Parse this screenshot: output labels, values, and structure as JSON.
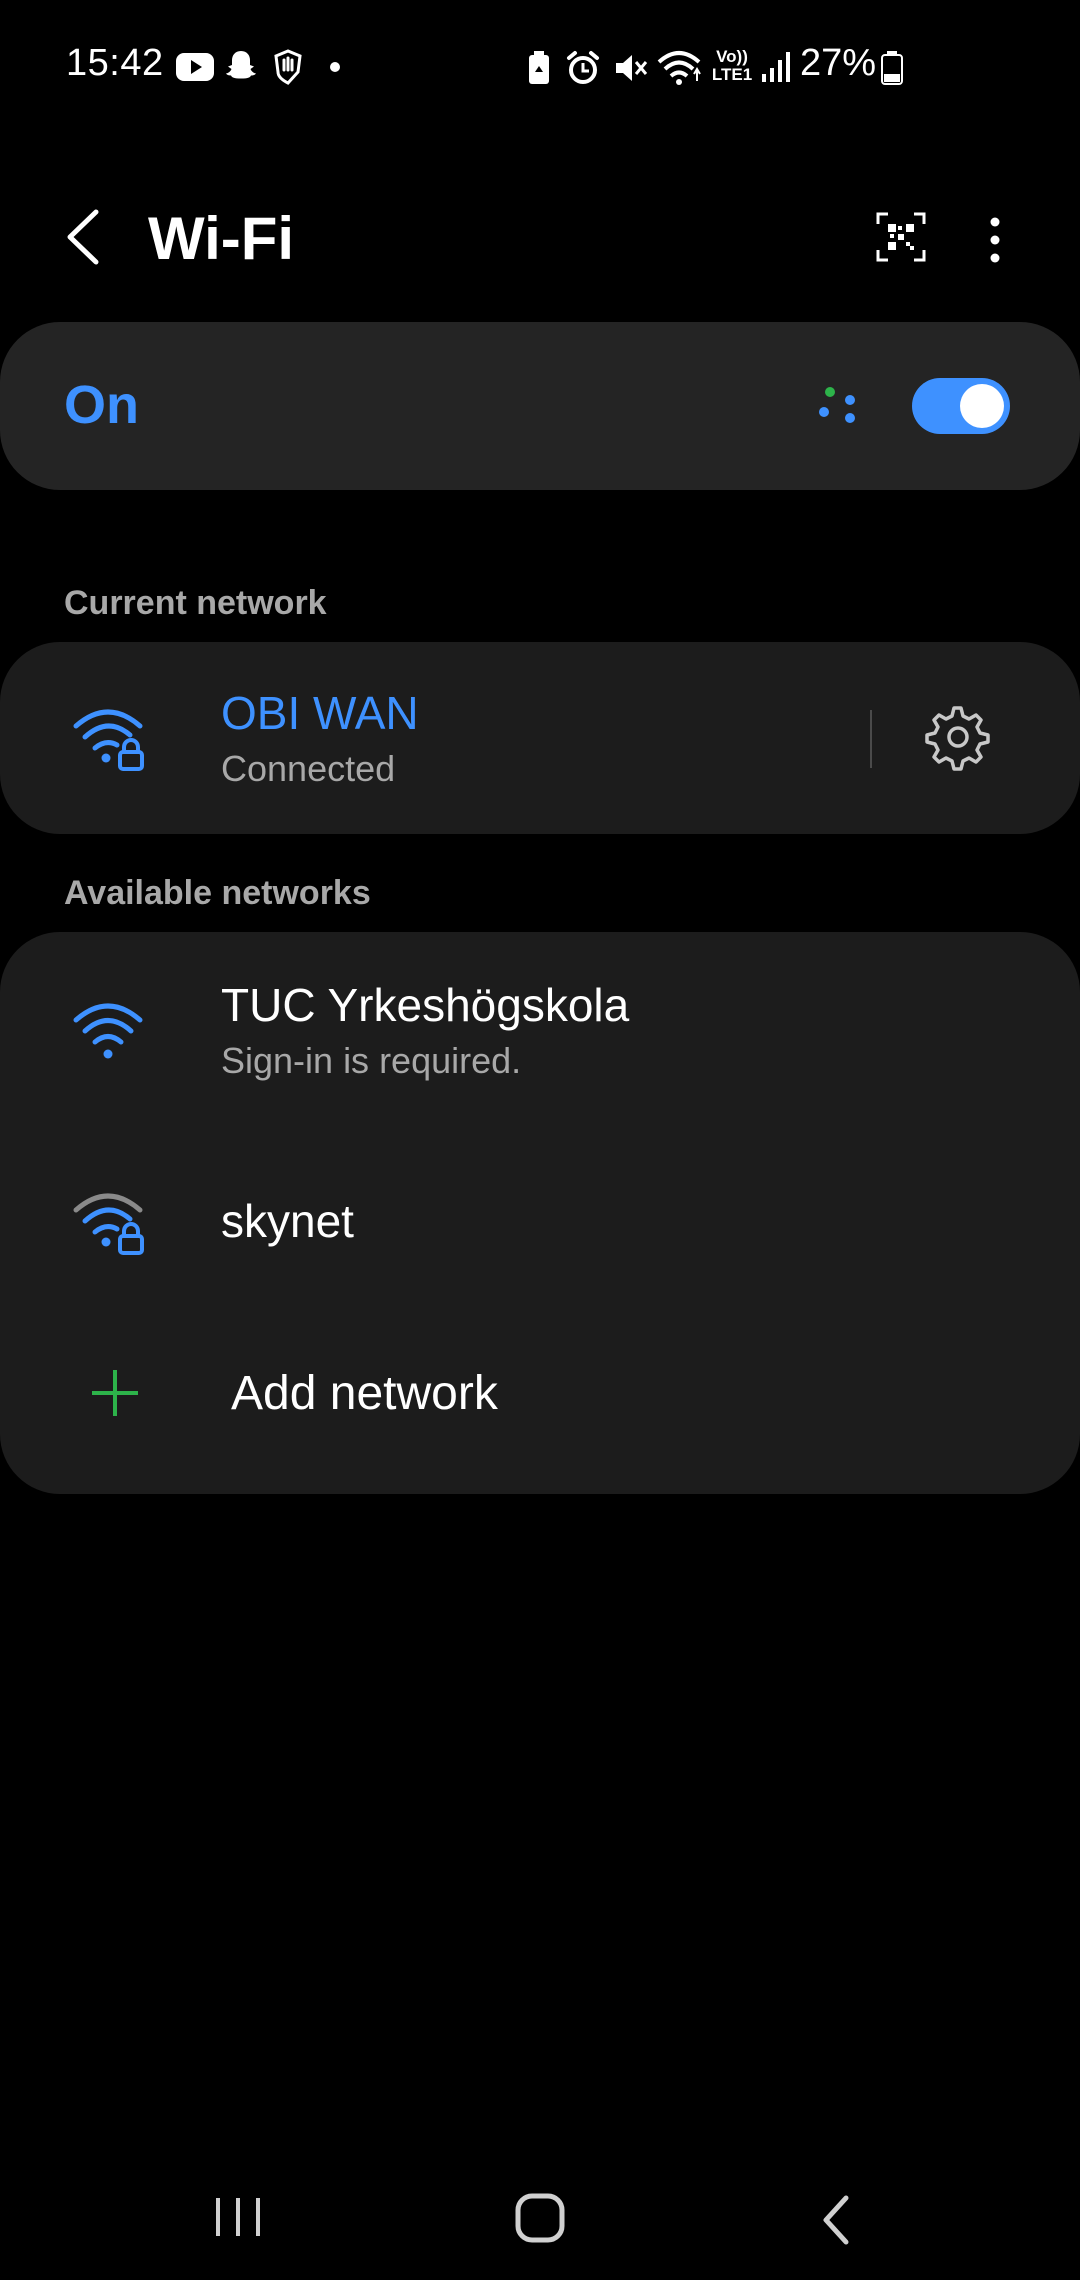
{
  "status_bar": {
    "time": "15:42",
    "battery_percent": "27%",
    "left_icons": [
      "youtube-icon",
      "snapchat-icon",
      "hand-icon",
      "dot-icon"
    ],
    "right_icons": [
      "battery-saver-icon",
      "alarm-icon",
      "mute-icon",
      "wifi-icon",
      "volte-icon",
      "signal-icon",
      "battery-icon"
    ],
    "volte_text": "Vo))",
    "lte_text": "LTE1"
  },
  "header": {
    "title": "Wi-Fi",
    "back_icon": "back-arrow-icon",
    "qr_icon": "qr-scanner-icon",
    "more_icon": "more-vert-icon"
  },
  "wifi_toggle": {
    "label": "On",
    "enabled": true
  },
  "current_network": {
    "section_title": "Current network",
    "name": "OBI WAN",
    "status": "Connected",
    "secured": true
  },
  "available_networks": {
    "section_title": "Available networks",
    "items": [
      {
        "name": "TUC Yrkeshögskola",
        "status": "Sign-in is required.",
        "secured": false
      },
      {
        "name": "skynet",
        "status": "",
        "secured": true
      }
    ],
    "add_label": "Add network"
  },
  "nav_bar": {
    "recents_icon": "recents-icon",
    "home_icon": "home-icon",
    "back_icon": "back-icon"
  },
  "colors": {
    "accent": "#3e91ff",
    "card_dark": "#1c1c1c",
    "card_toggle": "#242424",
    "green_plus": "#2db34a",
    "secondary_text": "#a8a8a8"
  }
}
